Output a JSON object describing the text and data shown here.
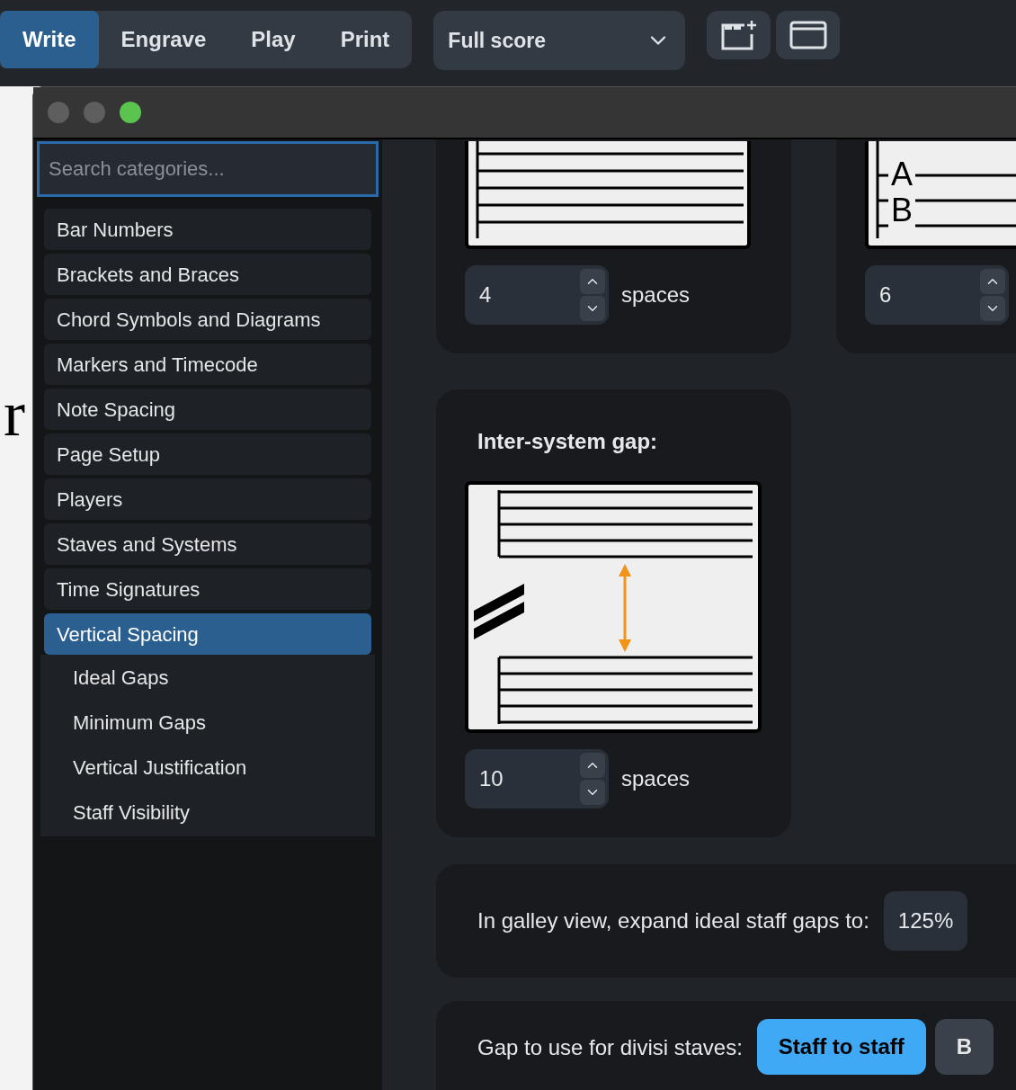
{
  "mode_tabs": [
    {
      "label": "Write",
      "selected": true
    },
    {
      "label": "Engrave",
      "selected": false
    },
    {
      "label": "Play",
      "selected": false
    },
    {
      "label": "Print",
      "selected": false
    }
  ],
  "layout_select": {
    "value": "Full score"
  },
  "background_score": {
    "text": "r"
  },
  "search": {
    "placeholder": "Search categories..."
  },
  "categories": [
    {
      "label": "Bar Numbers",
      "selected": false
    },
    {
      "label": "Brackets and Braces",
      "selected": false
    },
    {
      "label": "Chord Symbols and Diagrams",
      "selected": false
    },
    {
      "label": "Markers and Timecode",
      "selected": false
    },
    {
      "label": "Note Spacing",
      "selected": false
    },
    {
      "label": "Page Setup",
      "selected": false
    },
    {
      "label": "Players",
      "selected": false
    },
    {
      "label": "Staves and Systems",
      "selected": false
    },
    {
      "label": "Time Signatures",
      "selected": false
    },
    {
      "label": "Vertical Spacing",
      "selected": true,
      "expanded": true,
      "children": [
        {
          "label": "Ideal Gaps",
          "selected": false
        },
        {
          "label": "Minimum Gaps",
          "selected": false
        },
        {
          "label": "Vertical Justification",
          "selected": false
        },
        {
          "label": "Staff Visibility",
          "selected": false
        }
      ]
    }
  ],
  "top_cards": [
    {
      "kind": "staff",
      "value": "4",
      "unit": "spaces"
    },
    {
      "kind": "tab",
      "letters": [
        "A",
        "B"
      ],
      "value": "6"
    }
  ],
  "inter_system_gap": {
    "label": "Inter-system gap:",
    "value": "10",
    "unit": "spaces"
  },
  "galley": {
    "label": "In galley view, expand ideal staff gaps to:",
    "value": "125%"
  },
  "divisi": {
    "label": "Gap to use for divisi staves:",
    "options": [
      {
        "label": "Staff to staff",
        "selected": true
      },
      {
        "label": "B",
        "selected": false
      }
    ]
  }
}
